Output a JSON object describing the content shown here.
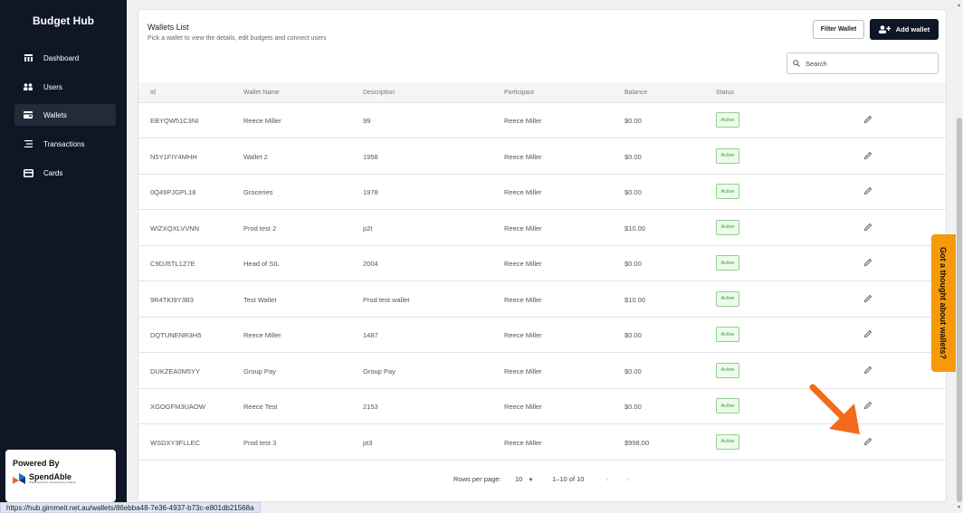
{
  "sidebar": {
    "brand": "Budget Hub",
    "items": [
      {
        "label": "Dashboard",
        "icon": "dashboard-icon"
      },
      {
        "label": "Users",
        "icon": "users-icon"
      },
      {
        "label": "Wallets",
        "icon": "wallet-icon",
        "active": true
      },
      {
        "label": "Transactions",
        "icon": "transactions-icon"
      },
      {
        "label": "Cards",
        "icon": "card-icon"
      }
    ],
    "powered_by": "Powered By",
    "logo_text": "SpendAble",
    "logo_tagline": "Enabling Choice, Empowering Change"
  },
  "main": {
    "title": "Wallets List",
    "subtitle": "Pick a wallet to view the details, edit budgets and connect users",
    "filter_label": "Filter Wallet",
    "add_label": "Add wallet",
    "search_placeholder": "Search"
  },
  "table": {
    "headers": [
      "Id",
      "Wallet Name",
      "Description",
      "Participant",
      "Balance",
      "Status"
    ],
    "rows": [
      {
        "id": "EBYQW51C3NI",
        "name": "Reece Miller",
        "desc": "99",
        "participant": "Reece Miller",
        "balance": "$0.00",
        "status": "Active"
      },
      {
        "id": "N5Y1FIY4MHH",
        "name": "Wallet 2",
        "desc": "1958",
        "participant": "Reece Miller",
        "balance": "$0.00",
        "status": "Active"
      },
      {
        "id": "0Q49PJGPL18",
        "name": "Groceries",
        "desc": "1978",
        "participant": "Reece Miller",
        "balance": "$0.00",
        "status": "Active"
      },
      {
        "id": "WIZXQXLVVNN",
        "name": "Prod test 2",
        "desc": "p2t",
        "participant": "Reece Miller",
        "balance": "$10.00",
        "status": "Active"
      },
      {
        "id": "C9DJ5TL1Z7E",
        "name": "Head of SIL",
        "desc": "2004",
        "participant": "Reece Miller",
        "balance": "$0.00",
        "status": "Active"
      },
      {
        "id": "9R4TKI9Y3B3",
        "name": "Test Wallet",
        "desc": "Prod test wallet",
        "participant": "Reece Miller",
        "balance": "$10.00",
        "status": "Active"
      },
      {
        "id": "DQTUNENR3H5",
        "name": "Reece Miller",
        "desc": "1487",
        "participant": "Reece Miller",
        "balance": "$0.00",
        "status": "Active"
      },
      {
        "id": "DUKZEA0M5YY",
        "name": "Group Pay",
        "desc": "Group Pay",
        "participant": "Reece Miller",
        "balance": "$0.00",
        "status": "Active"
      },
      {
        "id": "XGOGFM3UAOW",
        "name": "Reece Test",
        "desc": "2153",
        "participant": "Reece Miller",
        "balance": "$0.00",
        "status": "Active"
      },
      {
        "id": "WSDXY3FLLEC",
        "name": "Prod test 3",
        "desc": "pt3",
        "participant": "Reece Miller",
        "balance": "$998.00",
        "status": "Active"
      }
    ]
  },
  "pagination": {
    "rows_per_page_label": "Rows per page:",
    "rows_per_page_value": "10",
    "range": "1–10 of 10"
  },
  "feedback": {
    "label": "Got a thought about wallets?"
  },
  "status_url": "https://hub.gimmeit.net.au/wallets/86ebba48-7e36-4937-b73c-e801db21568a",
  "colors": {
    "sidebar": "#0f1626",
    "accent_orange": "#f59a0b",
    "active_green": "#2f9e3f"
  }
}
